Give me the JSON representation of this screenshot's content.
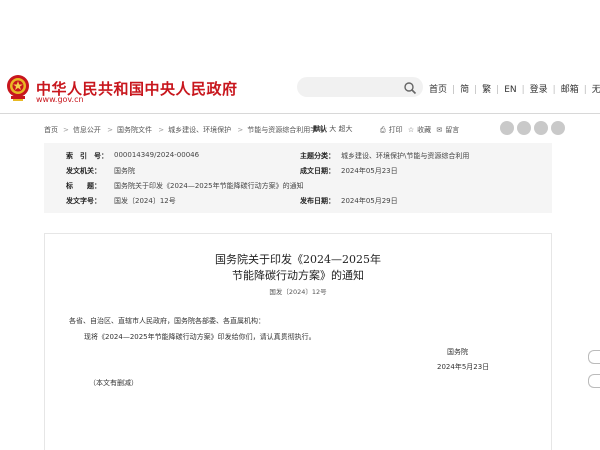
{
  "header": {
    "site_title": "中华人民共和国中央人民政府",
    "site_domain": "www.gov.cn",
    "search_placeholder": "",
    "links": [
      "首页",
      "简",
      "繁",
      "EN",
      "登录",
      "邮箱",
      "无障碍"
    ],
    "accent_color": "#c8161d"
  },
  "breadcrumb": {
    "home": "首页",
    "items": [
      "信息公开",
      "国务院文件",
      "城乡建设、环境保护",
      "节能与资源综合利用字号："
    ]
  },
  "font_size": {
    "default": "默认",
    "large": "大",
    "xlarge": "超大"
  },
  "tools": {
    "print": "打印",
    "favorite": "收藏",
    "keep": "留言"
  },
  "share_icons": [
    "wechat-icon",
    "weibo-icon",
    "qzone-icon",
    "more-icon"
  ],
  "info": {
    "index_label": "索　引　号：",
    "index_value": "000014349/2024-00046",
    "category_label": "主题分类：",
    "category_value": "城乡建设、环境保护\\节能与资源综合利用",
    "issuer_label": "发文机关：",
    "issuer_value": "国务院",
    "written_label": "成文日期：",
    "written_value": "2024年05月23日",
    "title_label": "标　　题：",
    "title_value": "国务院关于印发《2024—2025年节能降碳行动方案》的通知",
    "docno_label": "发文字号：",
    "docno_value": "国发〔2024〕12号",
    "publish_label": "发布日期：",
    "publish_value": "2024年05月29日"
  },
  "article": {
    "title_line1": "国务院关于印发《2024—2025年",
    "title_line2": "节能降碳行动方案》的通知",
    "doc_number": "国发〔2024〕12号",
    "recipients": "各省、自治区、直辖市人民政府，国务院各部委、各直属机构：",
    "body": "现将《2024—2025年节能降碳行动方案》印发给你们，请认真贯彻执行。",
    "signature": "国务院",
    "date": "2024年5月23日",
    "note": "（本文有删减）"
  }
}
